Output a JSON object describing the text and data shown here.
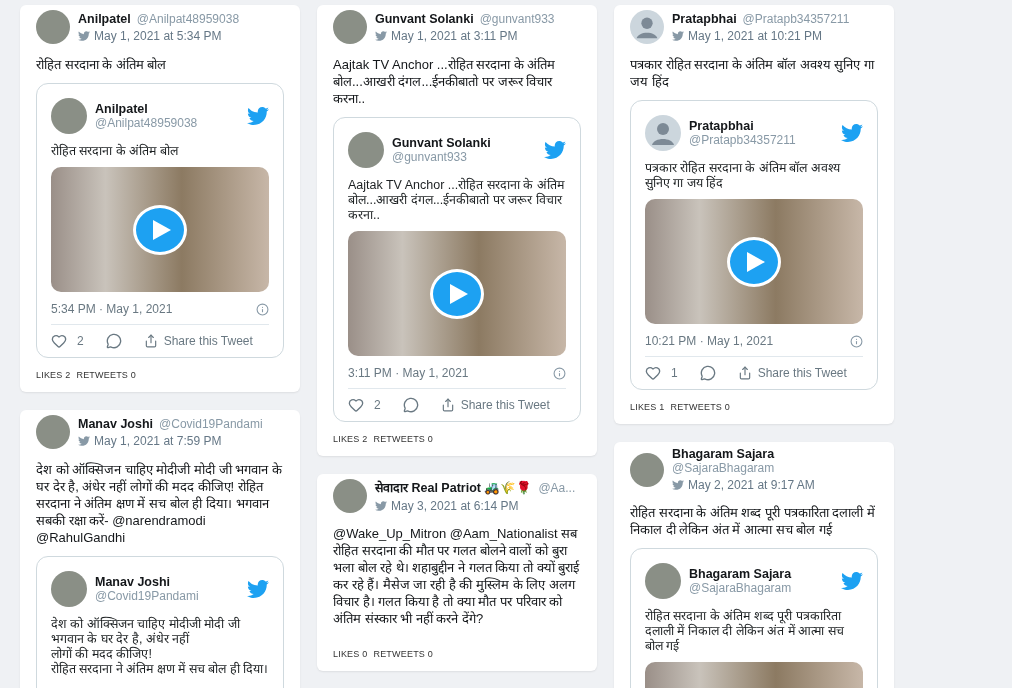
{
  "columns": [
    {
      "cards": [
        {
          "avatar_photo": true,
          "name": "Anilpatel",
          "handle": "@Anilpat48959038",
          "date": "May 1, 2021 at 5:34 PM",
          "text": "रोहित सरदाना के अंतिम बोल",
          "embed": {
            "avatar_photo": true,
            "name": "Anilpatel",
            "handle": "@Anilpat48959038",
            "text": "रोहित सरदाना के अंतिम बोल",
            "video": true,
            "timestamp": "5:34 PM · May 1, 2021",
            "likes": "2",
            "share": "Share this Tweet"
          },
          "likes_label": "LIKES",
          "likes": "2",
          "retweets_label": "RETWEETS",
          "retweets": "0"
        },
        {
          "avatar_photo": true,
          "name": "Manav Joshi",
          "handle": "@Covid19Pandami",
          "date": "May 1, 2021 at 7:59 PM",
          "text": "देश को ऑक्सिजन चाहिए मोदीजी मोदी जी भगवान के घर देर है, अंधेर नहीं लोगों की मदद कीजिए! रोहित सरदाना ने अंतिम क्षण में सच बोल ही दिया। भगवान सबकी रक्षा करें- @narendramodi @RahulGandhi",
          "embed": {
            "avatar_photo": true,
            "name": "Manav Joshi",
            "handle": "@Covid19Pandami",
            "text": "देश को ऑक्सिजन चाहिए मोदीजी मोदी जी\nभगवान के घर देर है, अंधेर नहीं\nलोगों की मदद कीजिए!\nरोहित सरदाना ने अंतिम क्षण में सच बोल ही दिया।"
          }
        }
      ]
    },
    {
      "cards": [
        {
          "avatar_photo": true,
          "name": "Gunvant Solanki",
          "handle": "@gunvant933",
          "date": "May 1, 2021 at 3:11 PM",
          "text": "Aajtak TV Anchor ...रोहित सरदाना के अंतिम बोल...आखरी दंगल...ईनकीबातो पर जरूर विचार करना..",
          "embed": {
            "avatar_photo": true,
            "name": "Gunvant Solanki",
            "handle": "@gunvant933",
            "text": "Aajtak TV Anchor ...रोहित सरदाना के अंतिम बोल...आखरी दंगल...ईनकीबातो पर जरूर विचार करना..",
            "video": true,
            "timestamp": "3:11 PM · May 1, 2021",
            "likes": "2",
            "share": "Share this Tweet"
          },
          "likes_label": "LIKES",
          "likes": "2",
          "retweets_label": "RETWEETS",
          "retweets": "0"
        },
        {
          "avatar_photo": true,
          "name": "सेवादार Real Patriot 🚜🌾🌹",
          "handle": "@Aa...",
          "date": "May 3, 2021 at 6:14 PM",
          "text": "@Wake_Up_Mitron @Aam_Nationalist सब रोहित सरदाना की मौत पर गलत बोलने वालों को बुरा भला बोल रहे थे। शहाबुद्दीन ने गलत किया तो क्यों बुराई कर रहे हैं। मैसेज जा रही है की मुस्लिम के लिए अलग विचार है। गलत किया है तो क्या मौत पर परिवार को अंतिम संस्कार भी नहीं करने देंगे?",
          "likes_label": "LIKES",
          "likes": "0",
          "retweets_label": "RETWEETS",
          "retweets": "0"
        }
      ]
    },
    {
      "cards": [
        {
          "avatar_photo": false,
          "name": "Pratapbhai",
          "handle": "@Pratapb34357211",
          "date": "May 1, 2021 at 10:21 PM",
          "text": "पत्रकार रोहित सरदाना के अंतिम बॉल अवश्य सुनिए गा जय हिंद",
          "embed": {
            "avatar_photo": false,
            "name": "Pratapbhai",
            "handle": "@Pratapb34357211",
            "text": "पत्रकार रोहित सरदाना के अंतिम बॉल अवश्य सुनिए गा जय हिंद",
            "video": true,
            "timestamp": "10:21 PM · May 1, 2021",
            "likes": "1",
            "share": "Share this Tweet"
          },
          "likes_label": "LIKES",
          "likes": "1",
          "retweets_label": "RETWEETS",
          "retweets": "0"
        },
        {
          "avatar_photo": true,
          "name": "Bhagaram Sajara",
          "handle": "@SajaraBhagaram",
          "date": "May 2, 2021 at 9:17 AM",
          "text": "रोहित सरदाना के अंतिम शब्द पूरी पत्रकारिता दलाली में निकाल दी लेकिन अंत में आत्मा सच बोल गई",
          "embed": {
            "avatar_photo": true,
            "name": "Bhagaram Sajara",
            "handle": "@SajaraBhagaram",
            "text": "रोहित सरदाना के अंतिम शब्द पूरी पत्रकारिता दलाली में निकाल दी लेकिन अंत में आत्मा सच बोल गई",
            "video": true
          }
        }
      ]
    }
  ]
}
